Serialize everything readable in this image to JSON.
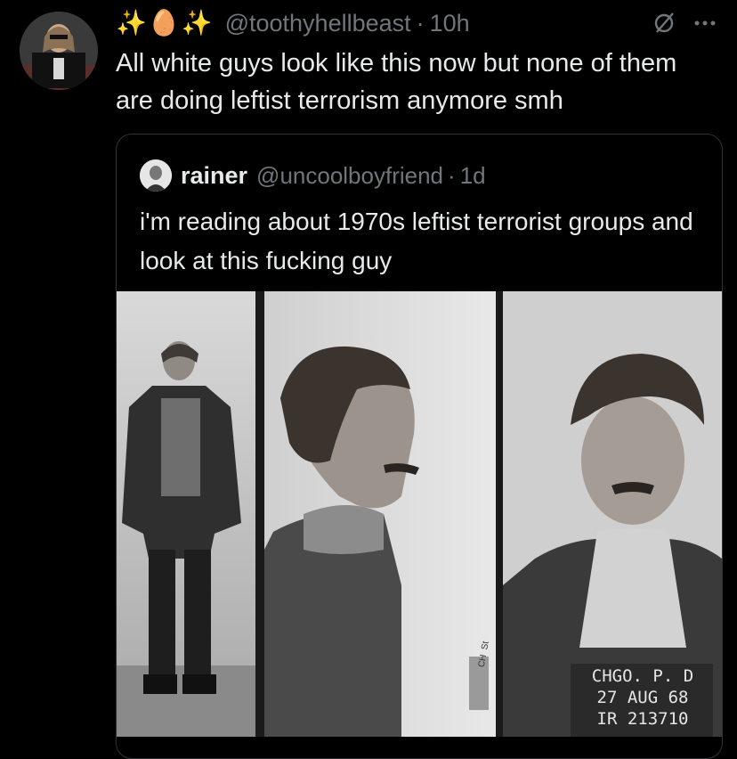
{
  "tweet": {
    "display_name": "✨🥚✨",
    "handle": "@toothyhellbeast",
    "separator": "·",
    "time": "10h",
    "text": "All white guys look like this now but none of them are doing leftist terrorism anymore smh"
  },
  "quoted_tweet": {
    "name": "rainer",
    "handle": "@uncoolboyfriend",
    "separator": "·",
    "time": "1d",
    "text": "i'm reading about 1970s leftist terrorist groups and look at this fucking guy",
    "image": {
      "placard_line1": "CHGO. P. D",
      "placard_line2": "27 AUG 68",
      "placard_line3": "IR 213710",
      "side_marks": "CH  St"
    }
  },
  "icons": {
    "grok": "slashed-circle-icon",
    "more": "more-dots-icon"
  }
}
